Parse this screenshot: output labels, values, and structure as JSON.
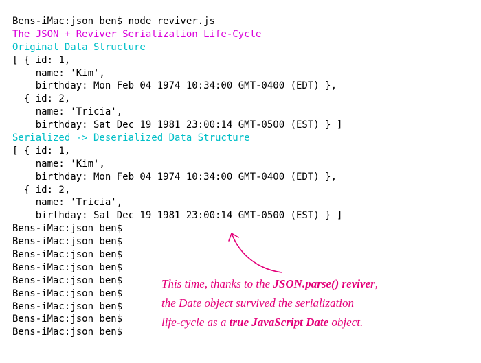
{
  "terminal": {
    "command_line": "Bens-iMac:json ben$ node reviver.js",
    "title_line": "The JSON + Reviver Serialization Life-Cycle",
    "heading_original": "Original Data Structure",
    "data_block": [
      "[ { id: 1,",
      "    name: 'Kim',",
      "    birthday: Mon Feb 04 1974 10:34:00 GMT-0400 (EDT) },",
      "  { id: 2,",
      "    name: 'Tricia',",
      "    birthday: Sat Dec 19 1981 23:00:14 GMT-0500 (EST) } ]"
    ],
    "heading_serialized": "Serialized -> Deserialized Data Structure",
    "prompt": "Bens-iMac:json ben$ ",
    "empty_prompt_count": 9
  },
  "annotation": {
    "line1_pre": "This time, thanks to the ",
    "line1_bold": "JSON.parse() reviver",
    "line1_post": ",",
    "line2": "the Date object survived the serialization",
    "line3_pre": "life-cycle as a ",
    "line3_bold": "true JavaScript Date",
    "line3_post": " object."
  }
}
